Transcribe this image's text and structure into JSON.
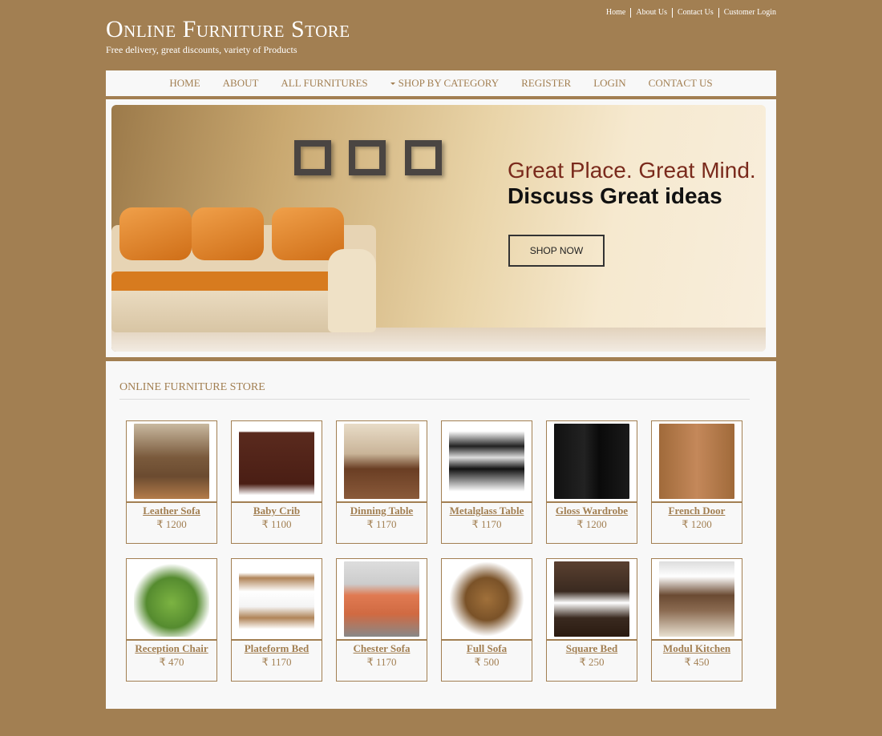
{
  "header": {
    "title": "Online Furniture Store",
    "tagline": "Free delivery, great discounts, variety of Products",
    "top_links": [
      "Home",
      "About Us",
      "Contact Us",
      "Customer Login"
    ]
  },
  "nav": {
    "items": [
      "HOME",
      "ABOUT",
      "ALL FURNITURES",
      "SHOP BY CATEGORY",
      "REGISTER",
      "LOGIN",
      "CONTACT US"
    ]
  },
  "banner": {
    "headline": "Great Place. Great Mind.",
    "subheadline": "Discuss Great ideas",
    "cta_label": "SHOP NOW"
  },
  "section": {
    "title": "ONLINE FURNITURE STORE"
  },
  "currency_symbol": "₹",
  "products": [
    {
      "name": "Leather Sofa",
      "price": "₹ 1200",
      "image": "leather-sofa-photo"
    },
    {
      "name": "Baby Crib",
      "price": "₹ 1100",
      "image": "baby-crib-photo"
    },
    {
      "name": "Dinning Table",
      "price": "₹ 1170",
      "image": "dining-table-photo"
    },
    {
      "name": "Metalglass Table",
      "price": "₹ 1170",
      "image": "metalglass-table-photo"
    },
    {
      "name": "Gloss Wardrobe",
      "price": "₹ 1200",
      "image": "gloss-wardrobe-photo"
    },
    {
      "name": "French Door",
      "price": "₹ 1200",
      "image": "french-door-photo"
    },
    {
      "name": "Reception Chair",
      "price": "₹ 470",
      "image": "reception-chair-photo"
    },
    {
      "name": "Plateform Bed",
      "price": "₹ 1170",
      "image": "platform-bed-photo"
    },
    {
      "name": "Chester Sofa",
      "price": "₹ 1170",
      "image": "chester-sofa-photo"
    },
    {
      "name": "Full Sofa",
      "price": "₹ 500",
      "image": "full-sofa-photo"
    },
    {
      "name": "Square Bed",
      "price": "₹ 250",
      "image": "square-bed-photo"
    },
    {
      "name": "Modul Kitchen",
      "price": "₹ 450",
      "image": "modular-kitchen-photo"
    }
  ],
  "colors": {
    "brand": "#a27f52",
    "panel": "#f8f8f8",
    "banner_headline": "#7a2a1c"
  }
}
